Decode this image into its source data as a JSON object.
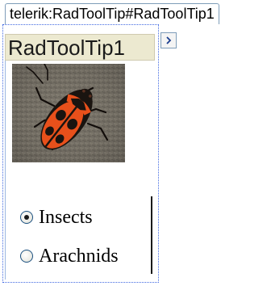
{
  "designer": {
    "tag_label": "telerik:RadToolTip#RadToolTip1"
  },
  "smart_tag": {
    "icon": "chevron-right-icon"
  },
  "tooltip": {
    "title": "RadToolTip1",
    "image_icon": "insect-photo",
    "radio_options": [
      {
        "label": "Insects",
        "checked": true
      },
      {
        "label": "Arachnids",
        "checked": false
      }
    ]
  },
  "colors": {
    "title_bar": "#ece9d0",
    "frame_dotted": "#4169e1",
    "bug_orange": "#e8501b",
    "bug_black": "#1a1410"
  }
}
